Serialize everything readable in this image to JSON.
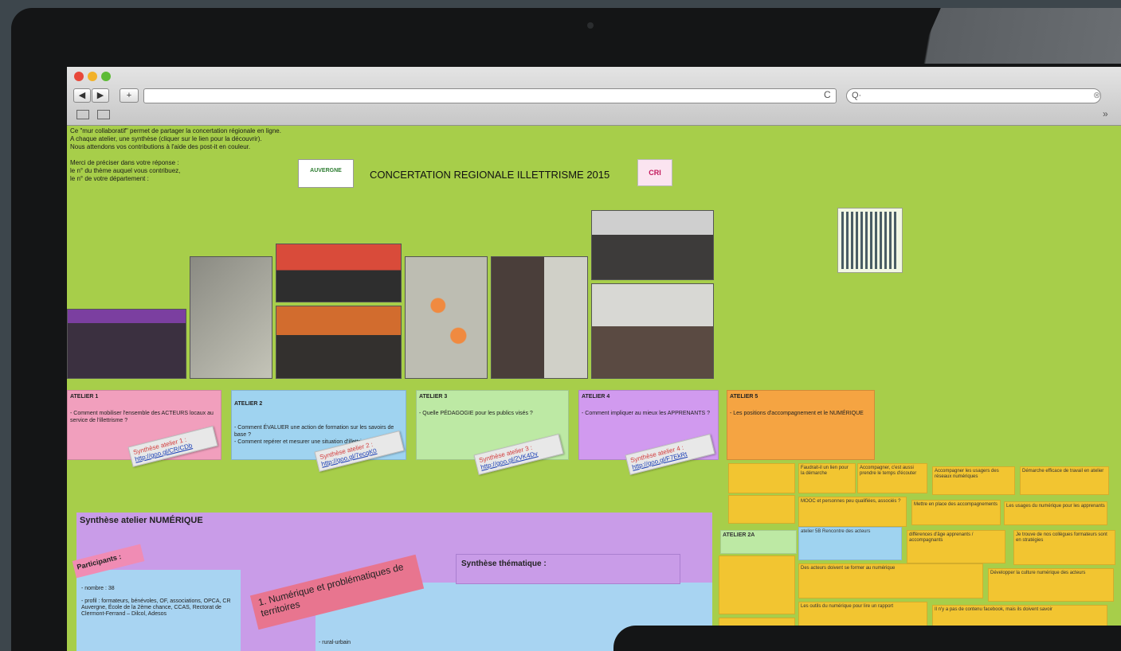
{
  "browser": {
    "search_placeholder": "Q·",
    "nav_back": "◀",
    "nav_forward": "▶",
    "new_tab": "+",
    "reload_icon": "C",
    "more": "»"
  },
  "page": {
    "intro_text": "Ce \"mur collaboratif\" permet de partager la concertation régionale en ligne.\nA chaque atelier, une synthèse (cliquer sur le lien pour la découvrir).\nNous attendons vos contributions à l'aide des post-it en couleur.\n\nMerci de préciser dans votre réponse :\nle n° du thème auquel vous contribuez,\nle n° de votre département :",
    "logo_text": "AUVERGNE",
    "title": "CONCERTATION REGIONALE ILLETTRISME 2015",
    "badge_text": "CRI"
  },
  "ateliers": [
    {
      "title": "ATELIER 1",
      "text": "- Comment mobiliser l'ensemble des ACTEURS locaux au service de l'illettrisme ?",
      "color": "#f19fbd",
      "link_label": "Synthèse atelier 1 :",
      "link_url": "http://goo.gl/CR/CDb"
    },
    {
      "title": "ATELIER 2",
      "text": "- Comment ÉVALUER une action de formation sur les savoirs de base ?\n- Comment repérer et mesurer une situation d'illettrisme ?",
      "color": "#9fd3f0",
      "link_label": "Synthèse atelier 2 :",
      "link_url": "http://goo.gl/7ecqK0"
    },
    {
      "title": "ATELIER 3",
      "text": "- Quelle PÉDAGOGIE pour les publics visés ?",
      "color": "#bde9a4",
      "link_label": "Synthèse atelier 3 :",
      "link_url": "http://goo.gl/2VK4Dv"
    },
    {
      "title": "ATELIER 4",
      "text": "- Comment impliquer au mieux les APPRENANTS ?",
      "color": "#d19aef",
      "link_label": "Synthèse atelier 4 :",
      "link_url": "http://goo.gl/F7EkRt"
    },
    {
      "title": "ATELIER 5",
      "text": "- Les positions d'accompagnement et le NUMÉRIQUE",
      "color": "#f5a442",
      "link_label": "",
      "link_url": ""
    }
  ],
  "atelier_extra": {
    "title": "ATELIER 2A"
  },
  "stickies": [
    "Faudrait-il un lien pour la démarche",
    "Accompagner, c'est aussi prendre le temps d'écouter",
    "Accompagner les usagers des réseaux numériques",
    "Démarche efficace de travail en atelier",
    "MOOC et personnes peu qualifiées, associés ?",
    "Mettre en place des accompagnements",
    "Les usages du numérique pour les apprenants",
    "atelier 5B Rencontre des acteurs",
    "différences d'âge apprenants / accompagnants",
    "Je trouve de nos collègues formateurs sont en stratégies",
    "Des acteurs doivent se former au numérique",
    "Développer la culture numérique des acteurs",
    "Les outils du numérique pour lire un rapport",
    "Il n'y a pas de contenu facebook, mais ils doivent savoir"
  ],
  "synthese": {
    "title": "Synthèse atelier NUMÉRIQUE",
    "participants_label": "Participants :",
    "participants_text": "- nombre : 38\n\n- profil : formateurs, bénévoles, OF, associations, OPCA, CR Auvergne, École de la 2ème chance, CCAS, Rectorat de Clermont-Ferrand – Dilcol, Adesos",
    "theme1": "1. Numérique et problématiques de territoires",
    "thematique": "Synthèse thématique :",
    "rural": "- rural-urbain"
  }
}
